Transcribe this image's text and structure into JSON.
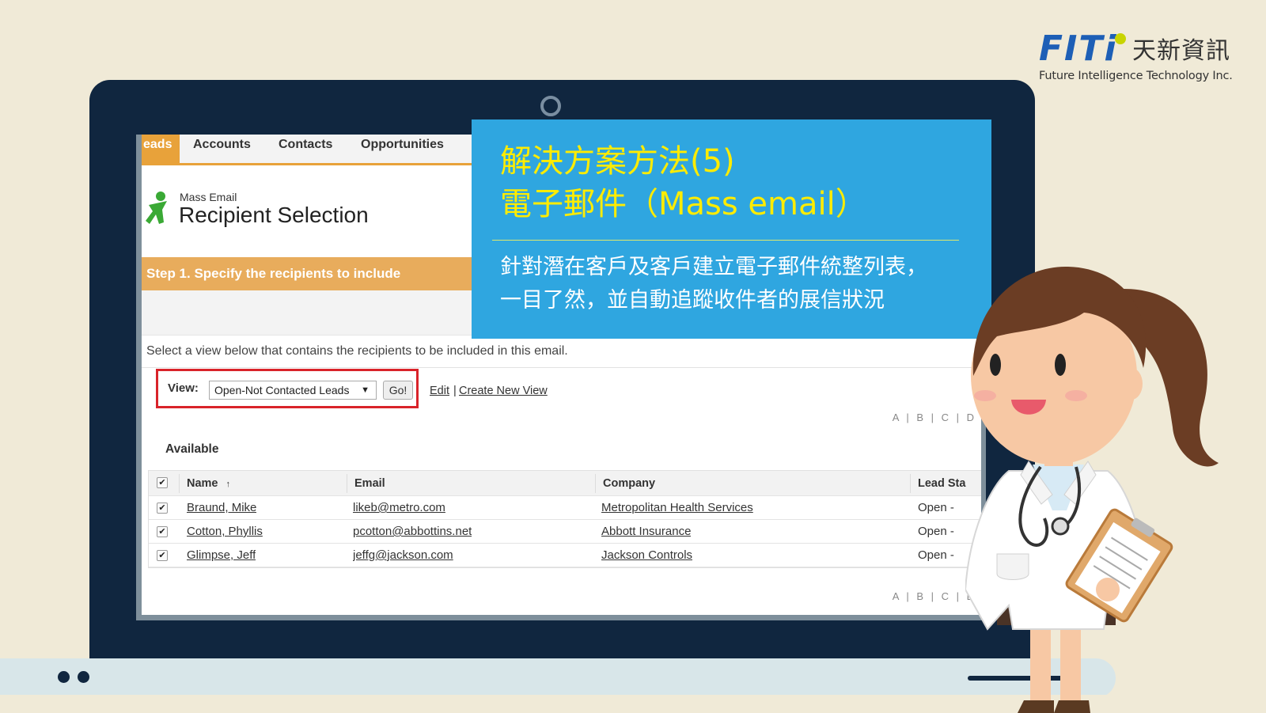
{
  "logo": {
    "mark": "FITi",
    "chinese": "天新資訊",
    "english": "Future Intelligence Technology Inc."
  },
  "tabs": [
    {
      "label": "eads",
      "active": true
    },
    {
      "label": "Accounts",
      "active": false
    },
    {
      "label": "Contacts",
      "active": false
    },
    {
      "label": "Opportunities",
      "active": false
    }
  ],
  "header": {
    "section_label": "Mass Email",
    "title": "Recipient Selection"
  },
  "step": {
    "label": "Step 1. Specify the recipients to include"
  },
  "instruction": "Select a view below that contains the recipients to be included in this email.",
  "view_selector": {
    "label": "View:",
    "selected": "Open-Not Contacted Leads",
    "go_label": "Go!",
    "edit_link": "Edit",
    "separator": "|",
    "create_link": "Create New View"
  },
  "alpha_nav": "A | B | C | D",
  "available_label": "Available",
  "table": {
    "columns": [
      "Name",
      "Email",
      "Company",
      "Lead Sta"
    ],
    "sort_indicator": "↑",
    "rows": [
      {
        "name": "Braund, Mike",
        "email": "likeb@metro.com",
        "company": "Metropolitan Health Services",
        "status": "Open - "
      },
      {
        "name": "Cotton, Phyllis",
        "email": "pcotton@abbottins.net",
        "company": "Abbott Insurance",
        "status": "Open - "
      },
      {
        "name": "Glimpse, Jeff",
        "email": "jeffg@jackson.com",
        "company": "Jackson Controls",
        "status": "Open - "
      }
    ]
  },
  "callout": {
    "title_line1": "解決方案方法(5)",
    "title_line2": "電子郵件（Mass email）",
    "body_line1": "針對潛在客戶及客戶建立電子郵件統整列表，",
    "body_line2": "一目了然，並自動追蹤收件者的展信狀況"
  },
  "colors": {
    "background": "#f0ead7",
    "laptop": "#10263f",
    "callout": "#2fa6e0",
    "callout_title": "#ffec00",
    "accent_orange": "#e8a23a",
    "highlight_red": "#d9232a"
  }
}
